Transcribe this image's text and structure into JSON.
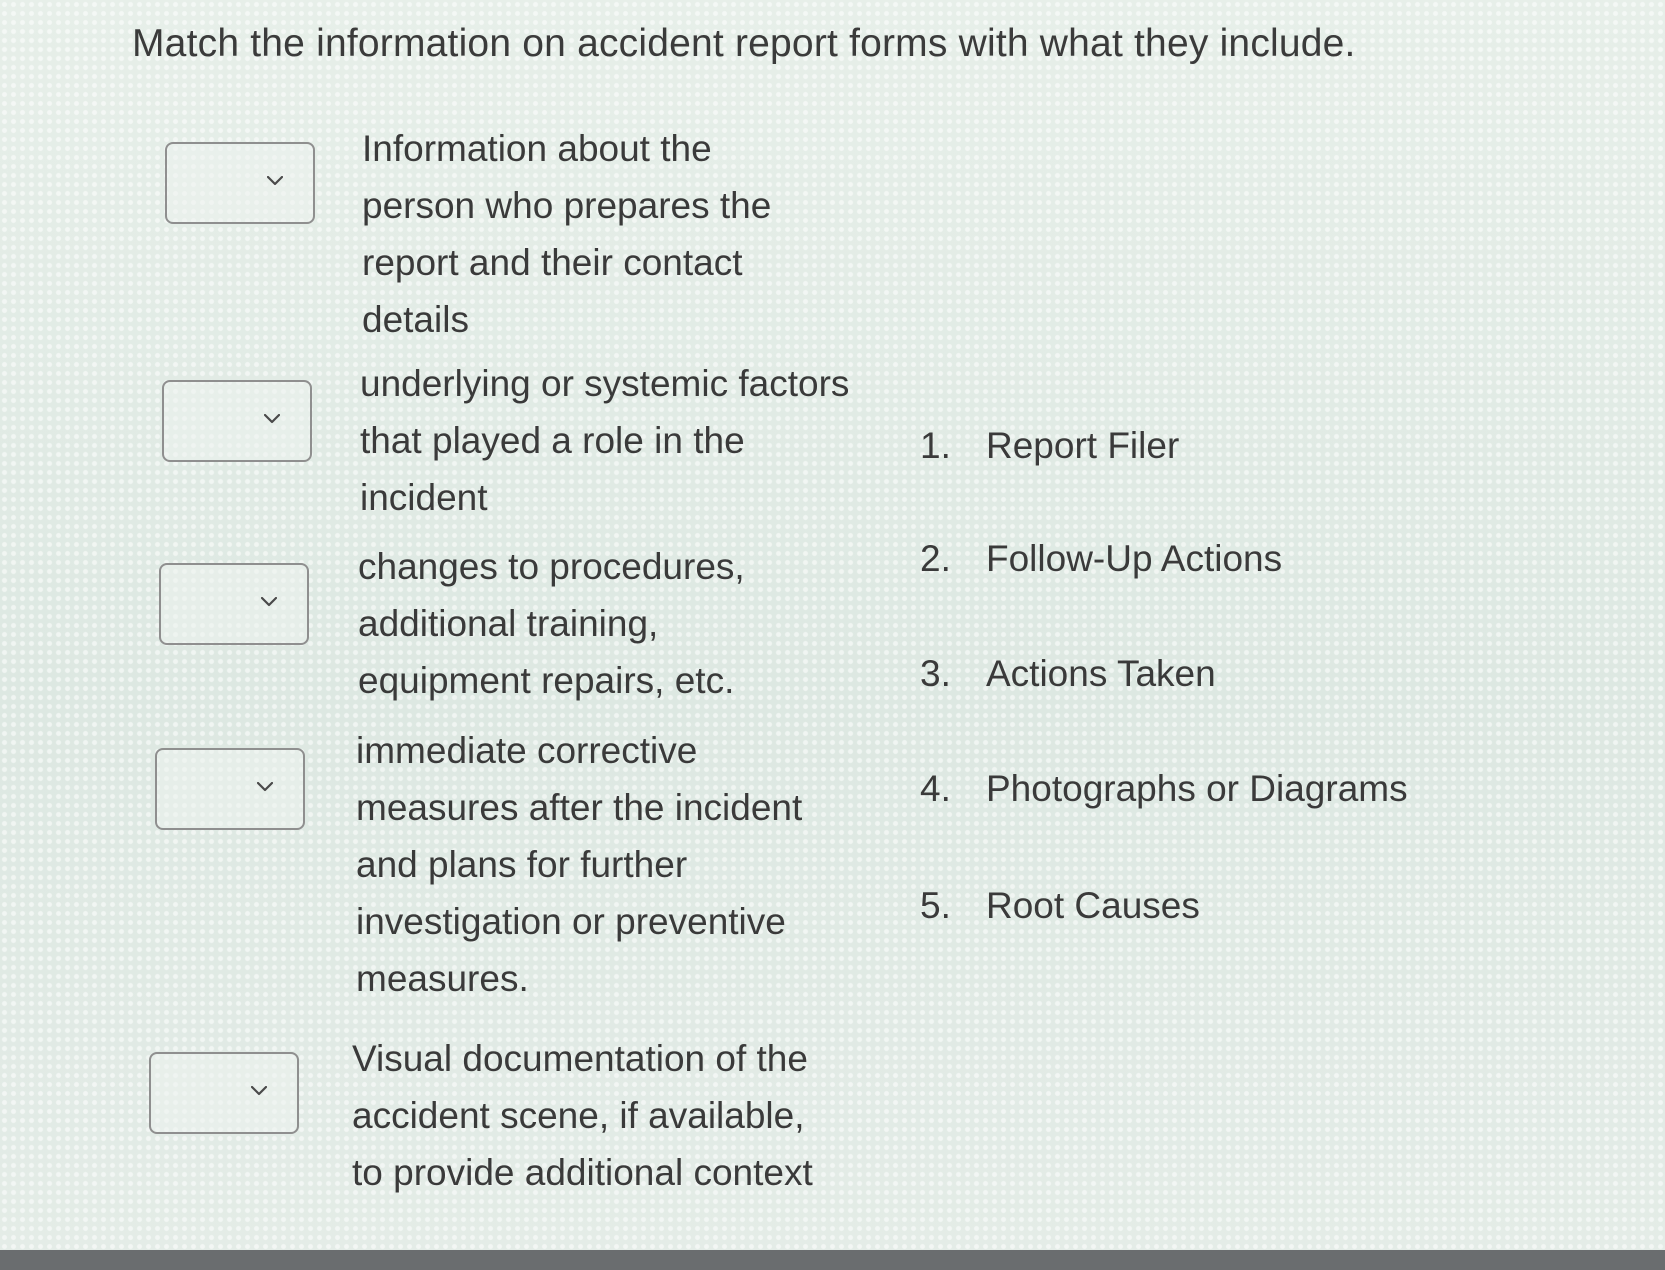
{
  "question": {
    "title": "Match the information on accident report forms with what they include."
  },
  "rows": [
    {
      "select_value": "",
      "description": "Information about the person who prepares the report and their contact details"
    },
    {
      "select_value": "",
      "description": "underlying or systemic factors that played a role in the incident"
    },
    {
      "select_value": "",
      "description": "changes to procedures, additional training, equipment repairs, etc."
    },
    {
      "select_value": "",
      "description": "immediate corrective measures after the incident and plans for further investigation or preventive measures."
    },
    {
      "select_value": "",
      "description": "Visual documentation of the accident scene, if available, to provide additional context"
    }
  ],
  "choices": [
    {
      "number": "1.",
      "label": "Report Filer"
    },
    {
      "number": "2.",
      "label": "Follow-Up Actions"
    },
    {
      "number": "3.",
      "label": "Actions Taken"
    },
    {
      "number": "4.",
      "label": "Photographs or Diagrams"
    },
    {
      "number": "5.",
      "label": "Root Causes"
    }
  ],
  "icons": {
    "dropdown": "chevron-down-icon"
  },
  "colors": {
    "text": "#3a3a3a",
    "select_border": "#8f8f8f",
    "background": "#dfe9e4"
  }
}
